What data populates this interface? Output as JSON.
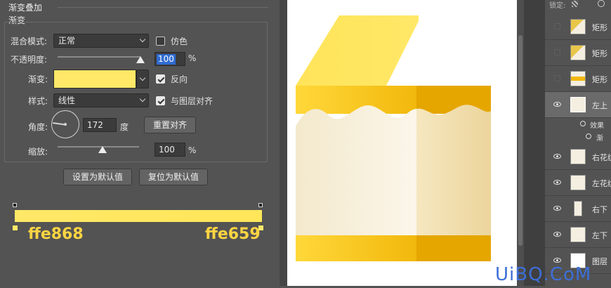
{
  "dialog": {
    "section_title": "渐变叠加",
    "group_title": "渐变",
    "blend_mode": {
      "label": "混合模式:",
      "value": "正常"
    },
    "dither": {
      "label": "仿色",
      "checked": false
    },
    "opacity": {
      "label": "不透明度:",
      "value": "100",
      "unit": "%",
      "level": 1.0
    },
    "gradient": {
      "label": "渐变:",
      "color": "#ffe868"
    },
    "reverse": {
      "label": "反向",
      "checked": true
    },
    "style": {
      "label": "样式:",
      "value": "线性"
    },
    "align_layer": {
      "label": "与图层对齐",
      "checked": true
    },
    "angle": {
      "label": "角度:",
      "value": "172",
      "unit": "度",
      "reset_button": "重置对齐"
    },
    "scale": {
      "label": "缩放:",
      "value": "100",
      "unit": "%",
      "level": 0.55
    },
    "make_default_button": "设置为默认值",
    "reset_default_button": "复位为默认值"
  },
  "gradient_editor": {
    "left_stop_hex": "ffe868",
    "right_stop_hex": "ffe659",
    "left_color": "#ffe868",
    "right_color": "#ffe659"
  },
  "layers": {
    "lock_label": "锁定:",
    "items": [
      {
        "name": "矩形",
        "visible": false,
        "thumb": "pattern"
      },
      {
        "name": "矩形",
        "visible": false,
        "thumb": "pattern"
      },
      {
        "name": "矩形",
        "visible": false,
        "thumb": "bar"
      },
      {
        "name": "左上",
        "visible": true,
        "thumb": "shape",
        "selected": true
      },
      {
        "name": "右花纹",
        "visible": true,
        "thumb": "cream"
      },
      {
        "name": "左花纹",
        "visible": true,
        "thumb": "cream"
      },
      {
        "name": "右下",
        "visible": true,
        "thumb": "small"
      },
      {
        "name": "左下",
        "visible": true,
        "thumb": "cream"
      },
      {
        "name": "图层",
        "visible": true,
        "thumb": "white"
      }
    ],
    "effects_label": "效果",
    "effect_item": "渐"
  },
  "watermark": "UiBQ.CoM",
  "colors": {
    "panel_bg": "#535353",
    "yellow_light": "#ffe868",
    "yellow_mid": "#f5c518",
    "yellow_dark": "#e5a600",
    "cream": "#f5edd8",
    "cream_dark": "#efdcaa",
    "accent_blue": "#3d6fd8"
  }
}
